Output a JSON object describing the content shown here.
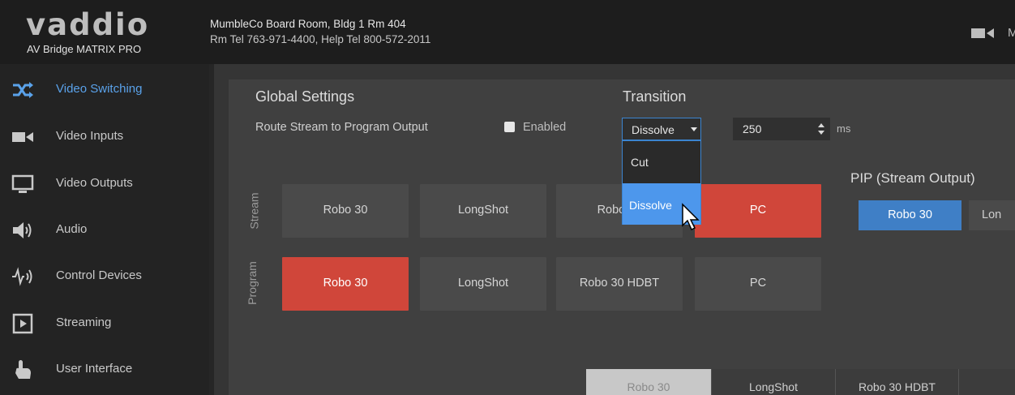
{
  "header": {
    "logo": "vaddio",
    "product": "AV Bridge MATRIX PRO",
    "room": "MumbleCo Board Room, Bldg 1 Rm 404",
    "phones": "Rm Tel 763-971-4400, Help Tel 800-572-2011",
    "right_label": "M"
  },
  "sidebar": {
    "items": [
      {
        "label": "Video Switching",
        "icon": "shuffle-icon",
        "active": true
      },
      {
        "label": "Video Inputs",
        "icon": "video-camera-icon"
      },
      {
        "label": "Video Outputs",
        "icon": "monitor-icon"
      },
      {
        "label": "Audio",
        "icon": "speaker-icon"
      },
      {
        "label": "Control Devices",
        "icon": "control-signal-icon"
      },
      {
        "label": "Streaming",
        "icon": "play-icon"
      },
      {
        "label": "User Interface",
        "icon": "hand-pointer-icon"
      }
    ]
  },
  "global_settings": {
    "title": "Global Settings",
    "route_label": "Route Stream to Program Output",
    "enabled_label": "Enabled"
  },
  "transition": {
    "title": "Transition",
    "selected": "Dissolve",
    "options": [
      "Cut",
      "Dissolve"
    ],
    "duration": "250",
    "unit": "ms"
  },
  "rows": {
    "stream_label": "Stream",
    "program_label": "Program",
    "stream_buttons": [
      "Robo 30",
      "LongShot",
      "Robo 30",
      "PC"
    ],
    "program_buttons": [
      "Robo 30",
      "LongShot",
      "Robo 30 HDBT",
      "PC"
    ]
  },
  "pip": {
    "title": "PIP (Stream Output)",
    "buttons": [
      "Robo 30",
      "Lon"
    ]
  },
  "bottom_tabs": [
    "Robo 30",
    "LongShot",
    "Robo 30 HDBT"
  ],
  "colors": {
    "accent_blue": "#4d97ec",
    "active_red": "#d0463a",
    "pip_blue": "#3f7fc6"
  }
}
